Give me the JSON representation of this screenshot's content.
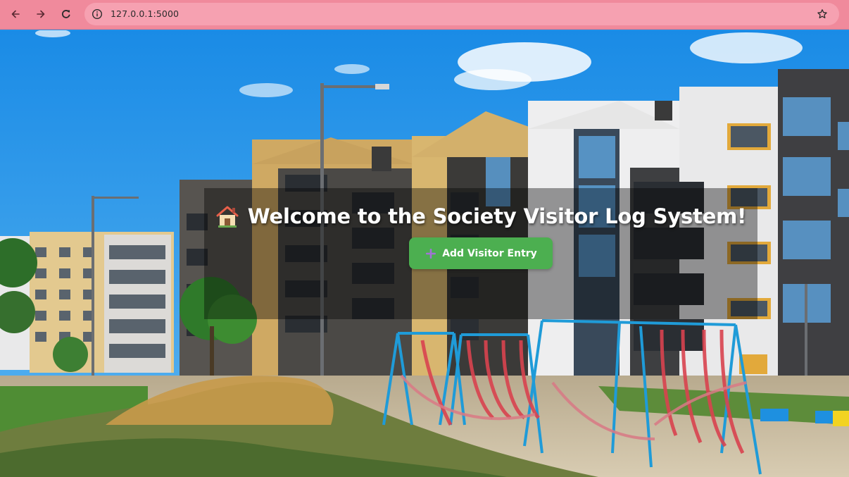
{
  "browser": {
    "url": "127.0.0.1:5000",
    "icons": {
      "back": "arrow-left-icon",
      "forward": "arrow-right-icon",
      "reload": "reload-icon",
      "site_info": "info-icon",
      "bookmark": "star-icon"
    },
    "colors": {
      "toolbar": "#f08a9c",
      "omnibox": "#f6a1b1"
    }
  },
  "hero": {
    "title": "Welcome to the Society Visitor Log System!",
    "title_icon": "house-icon",
    "add_button": {
      "label": "Add Visitor Entry",
      "icon": "plus-icon",
      "color": "#4caf50"
    }
  }
}
